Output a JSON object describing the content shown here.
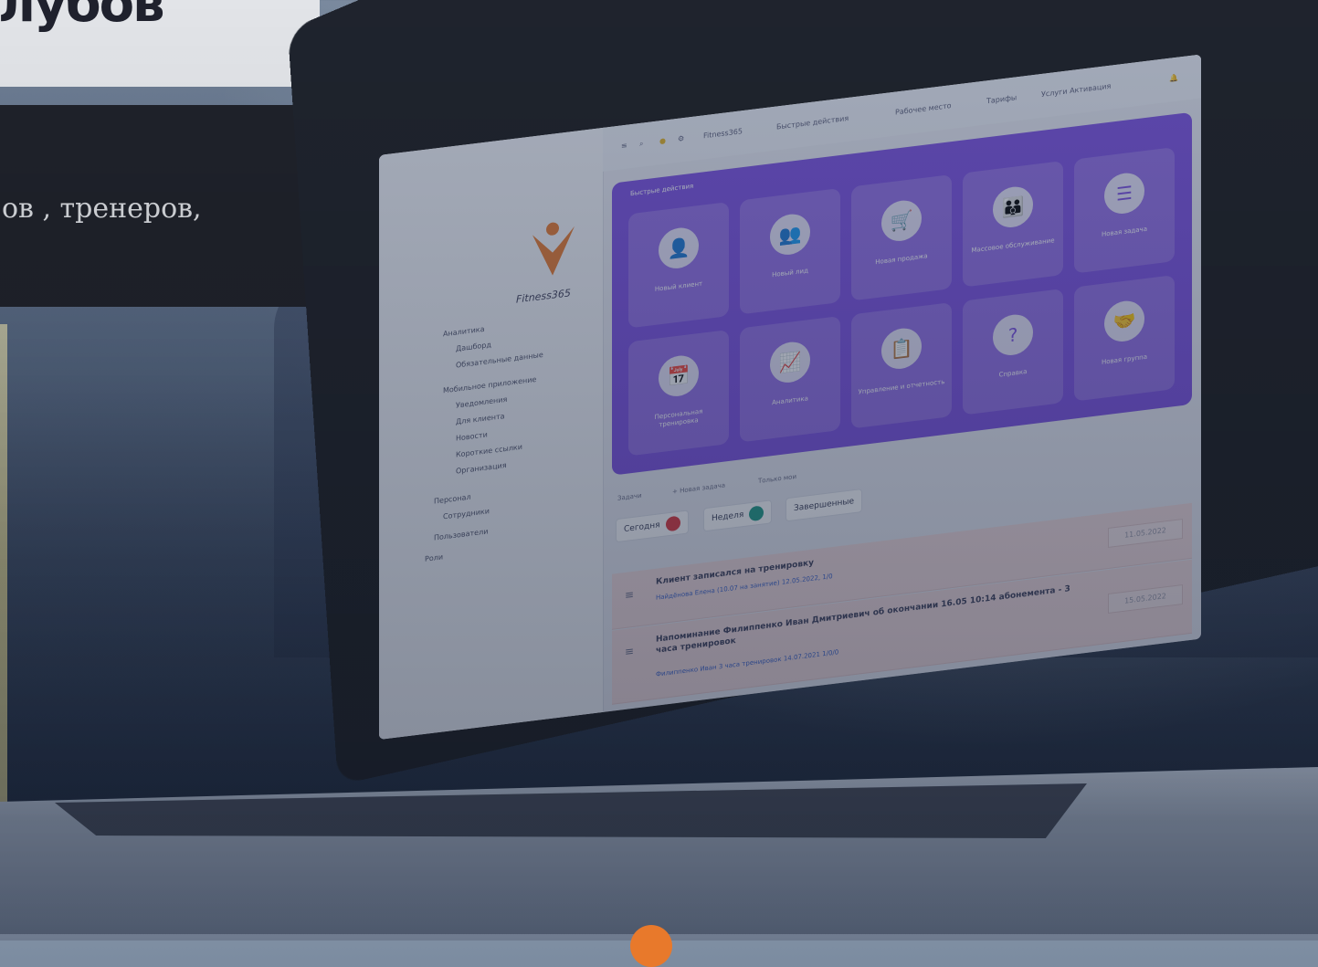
{
  "header": {
    "title_partial": "лубов",
    "subtitle_partial": "ов , тренеров,"
  },
  "app": {
    "logo_text": "Fitness365",
    "sidebar_items": [
      "Аналитика",
      "Дашборд",
      "Обязательные данные",
      "Мобильное приложение",
      "Уведомления",
      "Для клиента",
      "Новости",
      "Короткие ссылки",
      "Организация",
      "Персонал",
      "Сотрудники",
      "Пользователи",
      "Роли"
    ],
    "topbar_links": [
      "Fitness365",
      "Быстрые действия",
      "Рабочее место",
      "Тарифы",
      "Услуги Активация"
    ],
    "quick_actions_title": "Быстрые действия",
    "tiles": [
      {
        "label": "Новый клиент",
        "icon": "user-plus-icon",
        "glyph": "👤"
      },
      {
        "label": "Новый лид",
        "icon": "lead-icon",
        "glyph": "👥"
      },
      {
        "label": "Новая продажа",
        "icon": "sale-icon",
        "glyph": "🛒"
      },
      {
        "label": "Массовое обслуживание",
        "icon": "group-icon",
        "glyph": "👪"
      },
      {
        "label": "Новая задача",
        "icon": "task-list-icon",
        "glyph": "☰"
      },
      {
        "label": "Персональная тренировка",
        "icon": "calendar-icon",
        "glyph": "📅"
      },
      {
        "label": "Аналитика",
        "icon": "chart-icon",
        "glyph": "📈"
      },
      {
        "label": "Управление и отчетность",
        "icon": "report-icon",
        "glyph": "📋"
      },
      {
        "label": "Справка",
        "icon": "help-icon",
        "glyph": "?"
      },
      {
        "label": "Новая группа",
        "icon": "handshake-icon",
        "glyph": "🤝"
      }
    ],
    "tasks_label": "Задачи",
    "new_task_label": "+ Новая задача",
    "only_mine_label": "Только мои",
    "tabs": [
      {
        "label": "Сегодня",
        "badge_color": "#e0353b"
      },
      {
        "label": "Неделя",
        "badge_color": "#1e9c86"
      },
      {
        "label": "Завершенные",
        "badge_color": ""
      }
    ],
    "tasks": [
      {
        "title": "Клиент записался на тренировку",
        "sub": "Найдёнова Елена (10.07 на занятие) 12.05.2022, 1/0",
        "date": "11.05.2022"
      },
      {
        "title": "Напоминание Филиппенко Иван Дмитриевич об окончании 16.05 10:14 абонемента - 3 часа тренировок",
        "sub": "Филиппенко Иван 3 часа тренировок 14.07.2021 1/0/0",
        "date": "15.05.2022"
      }
    ]
  },
  "colors": {
    "purple": "#7a4ee0",
    "task_bg": "#f3dcdc",
    "accent_orange": "#e8792b"
  }
}
